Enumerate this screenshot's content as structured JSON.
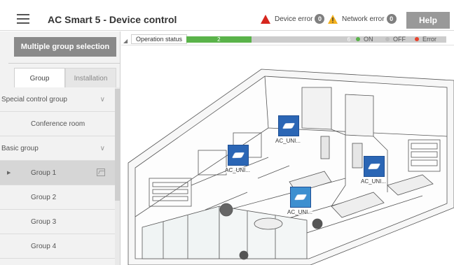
{
  "header": {
    "title": "AC Smart 5 - Device control",
    "device_error_label": "Device error",
    "device_error_count": "0",
    "network_error_label": "Network error",
    "network_error_count": "0",
    "help_label": "Help"
  },
  "sidebar": {
    "multi_select_label": "Multiple group selection",
    "tabs": [
      {
        "label": "Group",
        "active": true
      },
      {
        "label": "Installation",
        "active": false
      }
    ],
    "items": [
      {
        "label": "Special control group",
        "type": "header"
      },
      {
        "label": "Conference room",
        "type": "child"
      },
      {
        "label": "Basic group",
        "type": "header"
      },
      {
        "label": "Group 1",
        "type": "child",
        "selected": true
      },
      {
        "label": "Group 2",
        "type": "child"
      },
      {
        "label": "Group 3",
        "type": "child"
      },
      {
        "label": "Group 4",
        "type": "child"
      }
    ]
  },
  "operation": {
    "label": "Operation status",
    "on_count": "2",
    "off_count": "6",
    "on_fraction": 0.25,
    "legend_on": "ON",
    "legend_off": "OFF",
    "legend_error": "Error",
    "colors": {
      "on": "#5ab34a",
      "off": "#bbbbbb",
      "error": "#e8442e"
    }
  },
  "units": [
    {
      "label": "AC_UNI..."
    },
    {
      "label": "AC_UNI..."
    },
    {
      "label": "AC_UNI..."
    },
    {
      "label": "AC_UNI..."
    }
  ],
  "icons": {
    "menu": "hamburger-menu-icon",
    "device_error": "warning-triangle-red-icon",
    "network_error": "warning-triangle-yellow-icon",
    "group_image": "image-icon",
    "unit": "air-conditioner-icon"
  },
  "colors": {
    "brand_button": "#999999",
    "multi_button": "#8a8a8a",
    "unit_blue": "#2b66b5"
  }
}
